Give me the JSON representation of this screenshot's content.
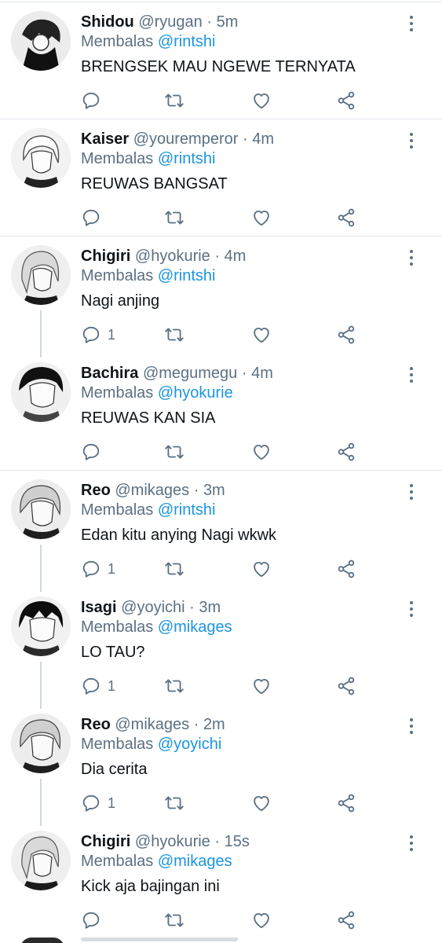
{
  "tweets": [
    {
      "name": "Shidou",
      "handle": "@ryugan",
      "time": "5m",
      "reply_label": "Membalas",
      "reply_to": "@rintshi",
      "text": "BRENGSEK MAU NGEWE TERNYATA",
      "reply_count": ""
    },
    {
      "name": "Kaiser",
      "handle": "@youremperor",
      "time": "4m",
      "reply_label": "Membalas",
      "reply_to": "@rintshi",
      "text": "REUWAS BANGSAT",
      "reply_count": ""
    },
    {
      "name": "Chigiri",
      "handle": "@hyokurie",
      "time": "4m",
      "reply_label": "Membalas",
      "reply_to": "@rintshi",
      "text": "Nagi anjing",
      "reply_count": "1"
    },
    {
      "name": "Bachira",
      "handle": "@megumegu",
      "time": "4m",
      "reply_label": "Membalas",
      "reply_to": "@hyokurie",
      "text": "REUWAS KAN SIA",
      "reply_count": ""
    },
    {
      "name": "Reo",
      "handle": "@mikages",
      "time": "3m",
      "reply_label": "Membalas",
      "reply_to": "@rintshi",
      "text": "Edan kitu anying Nagi wkwk",
      "reply_count": "1"
    },
    {
      "name": "Isagi",
      "handle": "@yoyichi",
      "time": "3m",
      "reply_label": "Membalas",
      "reply_to": "@mikages",
      "text": "LO TAU?",
      "reply_count": "1"
    },
    {
      "name": "Reo",
      "handle": "@mikages",
      "time": "2m",
      "reply_label": "Membalas",
      "reply_to": "@yoyichi",
      "text": "Dia cerita",
      "reply_count": "1"
    },
    {
      "name": "Chigiri",
      "handle": "@hyokurie",
      "time": "15s",
      "reply_label": "Membalas",
      "reply_to": "@mikages",
      "text": "Kick aja bajingan ini",
      "reply_count": ""
    }
  ],
  "separator": "·",
  "colors": {
    "accent": "#1b95e0",
    "muted": "#5b7083",
    "text": "#0f1419",
    "divider": "#e1e8ed"
  }
}
